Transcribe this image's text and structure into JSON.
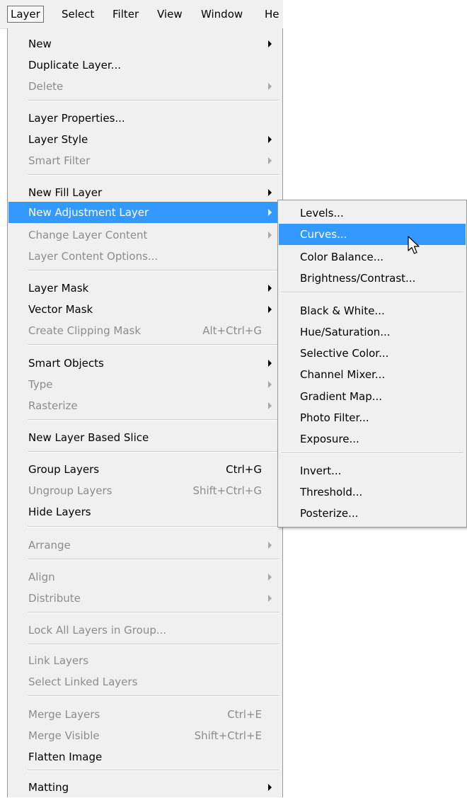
{
  "menubar": {
    "items": [
      "Layer",
      "Select",
      "Filter",
      "View",
      "Window",
      "He"
    ]
  },
  "layer_menu": {
    "items": [
      {
        "label": "New",
        "submenu": true,
        "enabled": true
      },
      {
        "label": "Duplicate Layer...",
        "enabled": true
      },
      {
        "label": "Delete",
        "submenu": true,
        "enabled": false
      },
      {
        "label": "Layer Properties...",
        "enabled": true
      },
      {
        "label": "Layer Style",
        "submenu": true,
        "enabled": true
      },
      {
        "label": "Smart Filter",
        "submenu": true,
        "enabled": false
      },
      {
        "label": "New Fill Layer",
        "submenu": true,
        "enabled": true
      },
      {
        "label": "New Adjustment Layer",
        "submenu": true,
        "enabled": true,
        "highlighted": true
      },
      {
        "label": "Change Layer Content",
        "submenu": true,
        "enabled": false
      },
      {
        "label": "Layer Content Options...",
        "enabled": false
      },
      {
        "label": "Layer Mask",
        "submenu": true,
        "enabled": true
      },
      {
        "label": "Vector Mask",
        "submenu": true,
        "enabled": true
      },
      {
        "label": "Create Clipping Mask",
        "shortcut": "Alt+Ctrl+G",
        "enabled": false
      },
      {
        "label": "Smart Objects",
        "submenu": true,
        "enabled": true
      },
      {
        "label": "Type",
        "submenu": true,
        "enabled": false
      },
      {
        "label": "Rasterize",
        "submenu": true,
        "enabled": false
      },
      {
        "label": "New Layer Based Slice",
        "enabled": true
      },
      {
        "label": "Group Layers",
        "shortcut": "Ctrl+G",
        "enabled": true
      },
      {
        "label": "Ungroup Layers",
        "shortcut": "Shift+Ctrl+G",
        "enabled": false
      },
      {
        "label": "Hide Layers",
        "enabled": true
      },
      {
        "label": "Arrange",
        "submenu": true,
        "enabled": false
      },
      {
        "label": "Align",
        "submenu": true,
        "enabled": false
      },
      {
        "label": "Distribute",
        "submenu": true,
        "enabled": false
      },
      {
        "label": "Lock All Layers in Group...",
        "enabled": false
      },
      {
        "label": "Link Layers",
        "enabled": false
      },
      {
        "label": "Select Linked Layers",
        "enabled": false
      },
      {
        "label": "Merge Layers",
        "shortcut": "Ctrl+E",
        "enabled": false
      },
      {
        "label": "Merge Visible",
        "shortcut": "Shift+Ctrl+E",
        "enabled": false
      },
      {
        "label": "Flatten Image",
        "enabled": true
      },
      {
        "label": "Matting",
        "submenu": true,
        "enabled": true
      }
    ]
  },
  "adjustment_submenu": {
    "items": [
      {
        "label": "Levels..."
      },
      {
        "label": "Curves...",
        "highlighted": true
      },
      {
        "label": "Color Balance..."
      },
      {
        "label": "Brightness/Contrast..."
      },
      {
        "label": "Black & White..."
      },
      {
        "label": "Hue/Saturation..."
      },
      {
        "label": "Selective Color..."
      },
      {
        "label": "Channel Mixer..."
      },
      {
        "label": "Gradient Map..."
      },
      {
        "label": "Photo Filter..."
      },
      {
        "label": "Exposure..."
      },
      {
        "label": "Invert..."
      },
      {
        "label": "Threshold..."
      },
      {
        "label": "Posterize..."
      }
    ]
  },
  "colors": {
    "highlight": "#3399ff",
    "menu_bg": "#f0f0f0",
    "disabled_text": "#8c8c8c"
  }
}
